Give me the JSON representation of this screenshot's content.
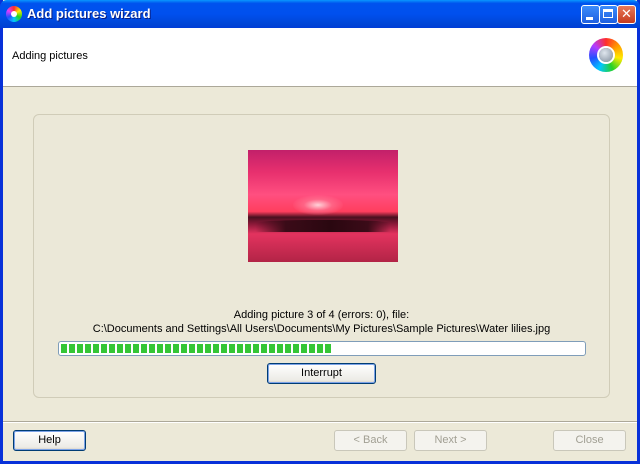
{
  "window": {
    "title": "Add pictures wizard",
    "title_icon": "color-disc-icon",
    "controls": {
      "minimize_icon": "minimize-icon",
      "maximize_icon": "maximize-icon",
      "close_icon": "close-icon",
      "close_glyph": "✕"
    }
  },
  "header": {
    "title": "Adding pictures",
    "logo": "color-disc-logo"
  },
  "main": {
    "status_line1": "Adding picture 3 of 4 (errors: 0), file:",
    "status_line2": "C:\\Documents and Settings\\All Users\\Documents\\My Pictures\\Sample Pictures\\Water lilies.jpg",
    "progress_fraction": 0.52,
    "interrupt_label": "Interrupt"
  },
  "footer": {
    "help_label": "Help",
    "back_label": "< Back",
    "next_label": "Next >",
    "close_label": "Close"
  },
  "colors": {
    "titlebar": "#0053ee",
    "progress_fill": "#35c635",
    "face": "#ece9d8"
  }
}
